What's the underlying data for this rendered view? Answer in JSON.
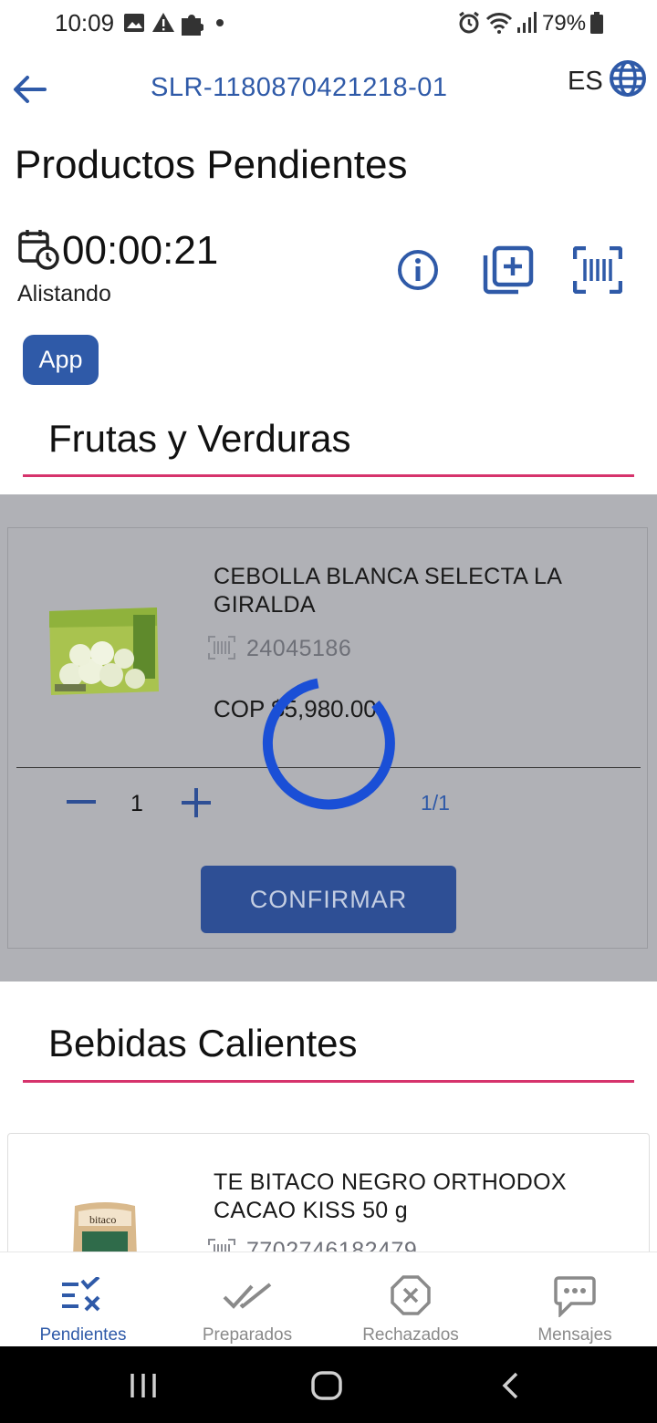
{
  "status_bar": {
    "time": "10:09",
    "battery": "79%",
    "icons": [
      "image-icon",
      "warning-icon",
      "puzzle-icon",
      "dot-icon",
      "alarm-icon",
      "wifi-icon",
      "signal-icon",
      "battery-icon"
    ]
  },
  "header": {
    "order_id": "SLR-1180870421218-01",
    "language": "ES",
    "title": "Productos Pendientes"
  },
  "timer": {
    "value": "00:00:21",
    "status": "Alistando"
  },
  "badge": "App",
  "sections": [
    {
      "title": "Frutas y Verduras",
      "products": [
        {
          "name_line1": "CEBOLLA BLANCA SELECTA LA",
          "name_line2": "GIRALDA",
          "sku": "24045186",
          "price": "COP $5,980.00",
          "quantity": "1",
          "count": "1/1",
          "confirm_label": "CONFIRMAR"
        }
      ]
    },
    {
      "title": "Bebidas Calientes",
      "products": [
        {
          "name_line1": "TE BITACO NEGRO ORTHODOX",
          "name_line2": "CACAO KISS 50 g",
          "sku": "7702746182479"
        }
      ]
    }
  ],
  "bottom_nav": [
    {
      "label": "Pendientes",
      "active": true
    },
    {
      "label": "Preparados",
      "active": false
    },
    {
      "label": "Rechazados",
      "active": false
    },
    {
      "label": "Mensajes",
      "active": false
    }
  ],
  "colors": {
    "accent": "#2f5aa8",
    "section_underline": "#d6336c",
    "spinner": "#1a4fd6",
    "overlay": "#b0b1b6"
  }
}
